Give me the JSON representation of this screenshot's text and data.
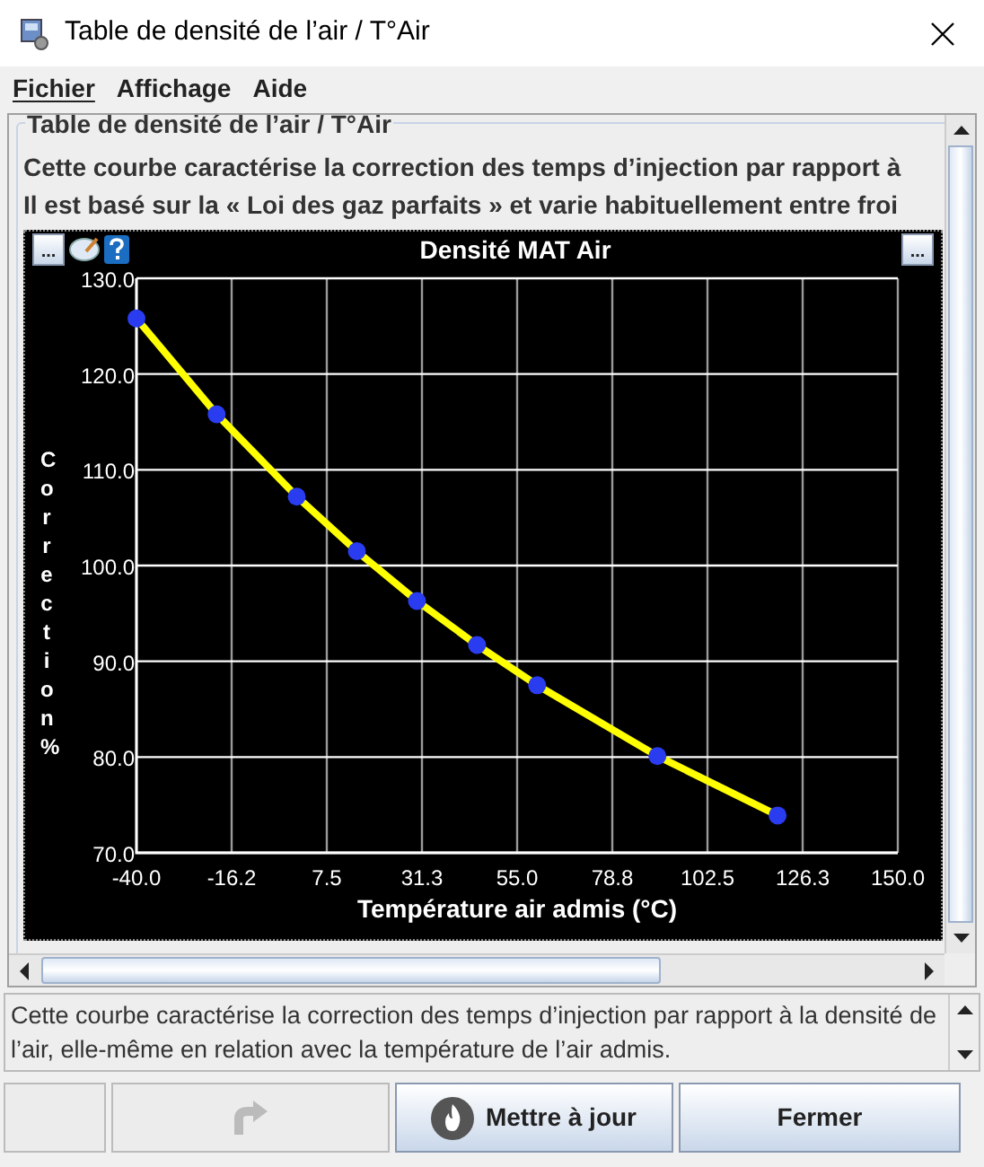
{
  "window": {
    "title": "Table de densité de l’air / T°Air"
  },
  "menu": [
    {
      "label": "Fichier",
      "mnemonic": true
    },
    {
      "label": "Affichage",
      "mnemonic": false
    },
    {
      "label": "Aide",
      "mnemonic": false
    }
  ],
  "group": {
    "title": "Table de densité de l’air / T°Air",
    "lines": [
      "Cette courbe caractérise la correction des temps d’injection par rapport à",
      "Il est basé sur la « Loi des gaz parfaits » et varie habituellement entre froi"
    ]
  },
  "chart_panel": {
    "title": "Densité MAT Air",
    "left_button": "...",
    "right_button": "...",
    "chart_data": {
      "type": "line",
      "xlabel": "Température air admis (°C)",
      "ylabel": "Correction %",
      "xlim": [
        -40,
        150
      ],
      "ylim": [
        70,
        130
      ],
      "xticks": [
        {
          "value": -40,
          "label": "-40.0"
        },
        {
          "value": -16.25,
          "label": "-16.2"
        },
        {
          "value": 7.5,
          "label": "7.5"
        },
        {
          "value": 31.25,
          "label": "31.3"
        },
        {
          "value": 55,
          "label": "55.0"
        },
        {
          "value": 78.75,
          "label": "78.8"
        },
        {
          "value": 102.5,
          "label": "102.5"
        },
        {
          "value": 126.25,
          "label": "126.3"
        },
        {
          "value": 150,
          "label": "150.0"
        }
      ],
      "yticks": [
        {
          "value": 70,
          "label": "70.0"
        },
        {
          "value": 80,
          "label": "80.0"
        },
        {
          "value": 90,
          "label": "90.0"
        },
        {
          "value": 100,
          "label": "100.0"
        },
        {
          "value": 110,
          "label": "110.0"
        },
        {
          "value": 120,
          "label": "120.0"
        },
        {
          "value": 130,
          "label": "130.0"
        }
      ],
      "x": [
        -40,
        -20,
        0,
        15,
        30,
        45,
        60,
        90,
        120
      ],
      "grid": true,
      "series": [
        {
          "color": "#ffff00",
          "marker": "circle",
          "values": [
            125.8,
            115.8,
            107.2,
            101.5,
            96.3,
            91.7,
            87.5,
            80.1,
            73.9
          ]
        }
      ]
    }
  },
  "description": "Cette courbe caractérise la correction des temps d’injection par rapport à la densité de l’air, elle-même en relation avec la température de l’air admis.",
  "buttons": [
    {
      "kind": "blank",
      "disabled": true
    },
    {
      "kind": "icon",
      "disabled": true
    },
    {
      "kind": "update",
      "label": "Mettre à jour",
      "disabled": false
    },
    {
      "kind": "text",
      "label": "Fermer",
      "disabled": false
    }
  ]
}
